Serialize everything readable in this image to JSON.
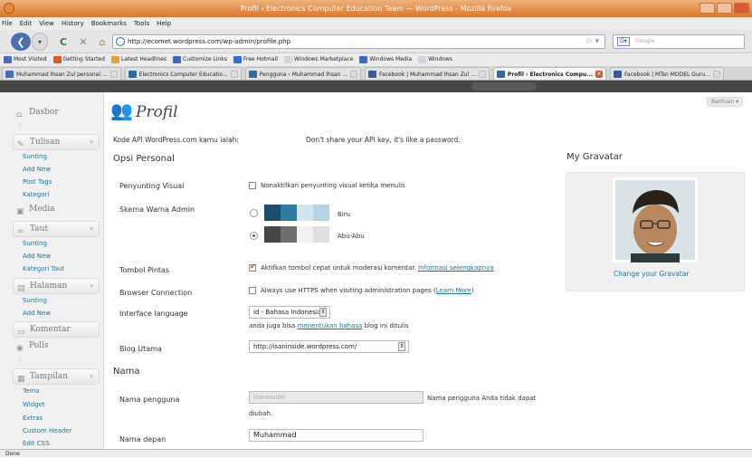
{
  "window": {
    "title": "Profil ‹ Electronics Computer Education Team — WordPress - Mozilla Firefox"
  },
  "menubar": [
    "File",
    "Edit",
    "View",
    "History",
    "Bookmarks",
    "Tools",
    "Help"
  ],
  "nav": {
    "url": "http://ecomet.wordpress.com/wp-admin/profile.php",
    "search_placeholder": "Google"
  },
  "bookmarks": [
    {
      "label": "Most Visited",
      "color": "#4a6fb0"
    },
    {
      "label": "Getting Started",
      "color": "#e05a1e"
    },
    {
      "label": "Latest Headlines",
      "color": "#e8a030"
    },
    {
      "label": "Customize Links",
      "color": "#3a6ad0"
    },
    {
      "label": "Free Hotmail",
      "color": "#3a6ad0"
    },
    {
      "label": "Windows Marketplace",
      "color": "#cfd6e0"
    },
    {
      "label": "Windows Media",
      "color": "#3a6ad0"
    },
    {
      "label": "Windows",
      "color": "#cfd6e0"
    }
  ],
  "tabs": [
    {
      "label": "Muhammad Ihsan Zul personal ...",
      "color": "#4a6fb0",
      "active": false
    },
    {
      "label": "Electronics Computer Educatio...",
      "color": "#2f6aa0",
      "active": false
    },
    {
      "label": "Pengguna ‹ Muhammad Ihsan ...",
      "color": "#2f6aa0",
      "active": false
    },
    {
      "label": "Facebook | Muhammad Ihsan Zul ...",
      "color": "#3b5998",
      "active": false
    },
    {
      "label": "Profil ‹ Electronics Compu...",
      "color": "#2f6aa0",
      "active": true
    },
    {
      "label": "Facebook | MTsn MODEL Guru...",
      "color": "#3b5998",
      "active": false
    }
  ],
  "sidebar": {
    "dasbor": "Dasbor",
    "tulisan": "Tulisan",
    "tulisan_items": [
      "Sunting",
      "Add New",
      "Post Tags",
      "Kategori"
    ],
    "media": "Media",
    "taut": "Taut",
    "taut_items": [
      "Sunting",
      "Add New",
      "Kategori Taut"
    ],
    "halaman": "Halaman",
    "halaman_items": [
      "Sunting",
      "Add New"
    ],
    "komentar": "Komentar",
    "polls": "Polls",
    "tampilan": "Tampilan",
    "tampilan_items": [
      "Tema",
      "Widget",
      "Extras",
      "Custom Header",
      "Edit CSS"
    ]
  },
  "main": {
    "title": "Profil",
    "help": "Bantuan",
    "api_label": "Kode API WordPress.com kamu ialah:",
    "api_note": "Don't share your API key, it's like a password.",
    "opsi_personal": "Opsi Personal",
    "penyunting_label": "Penyunting Visual",
    "penyunting_text": "Nonaktifkan penyunting visual ketika menulis",
    "skema_label": "Skema Warna Admin",
    "scheme_biru": "Biru",
    "scheme_abu": "Abu-Abu",
    "scheme_selected": "Abu-Abu",
    "biru_colors": [
      "#1e4d6b",
      "#2f7ca0",
      "#d2e4ee",
      "#b4d4e4"
    ],
    "abu_colors": [
      "#464646",
      "#6d6d6d",
      "#f1f1f1",
      "#dfdfdf"
    ],
    "tombol_label": "Tombol Pintas",
    "tombol_text": "Aktifkan tombol cepat untuk moderasi komentar.",
    "tombol_link": "Informasi selengkapnya",
    "browser_label": "Browser Connection",
    "browser_text": "Always use HTTPS when visiting administration pages (",
    "browser_link": "Learn More",
    "browser_close": ")",
    "lang_label": "Interface language",
    "lang_value": "id - Bahasa Indonesia",
    "lang_note_pre": "anda juga bisa ",
    "lang_note_link": "menentukan bahasa",
    "lang_note_post": " blog ini ditulis",
    "blog_label": "Blog Utama",
    "blog_value": "http://isaninside.wordpress.com/",
    "nama_section": "Nama",
    "username_label": "Nama pengguna",
    "username_value": "isaninside",
    "username_note1": "Nama pengguna Anda tidak dapat",
    "username_note2": "diubah.",
    "firstname_label": "Nama depan",
    "firstname_value": "Muhammad"
  },
  "gravatar": {
    "title": "My Gravatar",
    "change": "Change your Gravatar"
  },
  "status": "Done"
}
